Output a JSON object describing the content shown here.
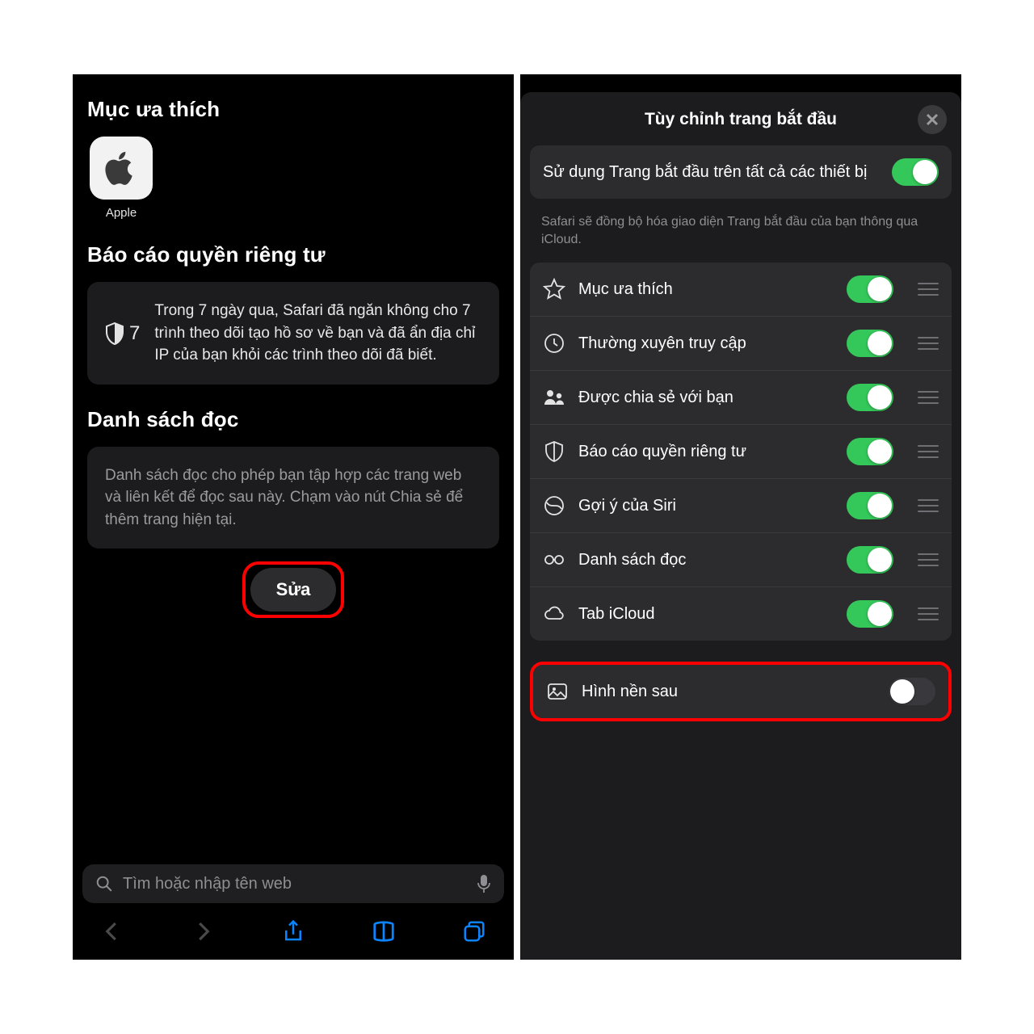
{
  "left": {
    "favorites_title": "Mục ưa thích",
    "favorite_label": "Apple",
    "privacy_title": "Báo cáo quyền riêng tư",
    "privacy_count": "7",
    "privacy_text": "Trong 7 ngày qua, Safari đã ngăn không cho 7 trình theo dõi tạo hồ sơ về bạn và đã ẩn địa chỉ IP của bạn khỏi các trình theo dõi đã biết.",
    "reading_title": "Danh sách đọc",
    "reading_text": "Danh sách đọc cho phép bạn tập hợp các trang web và liên kết để đọc sau này. Chạm vào nút Chia sẻ để thêm trang hiện tại.",
    "edit_label": "Sửa",
    "search_placeholder": "Tìm hoặc nhập tên web"
  },
  "right": {
    "sheet_title": "Tùy chỉnh trang bắt đầu",
    "sync_label": "Sử dụng Trang bắt đầu trên tất cả các thiết bị",
    "sync_footer": "Safari sẽ đồng bộ hóa giao diện Trang bắt đầu của bạn thông qua iCloud.",
    "rows": [
      {
        "label": "Mục ưa thích"
      },
      {
        "label": "Thường xuyên truy cập"
      },
      {
        "label": "Được chia sẻ với bạn"
      },
      {
        "label": "Báo cáo quyền riêng tư"
      },
      {
        "label": "Gợi ý của Siri"
      },
      {
        "label": "Danh sách đọc"
      },
      {
        "label": "Tab iCloud"
      }
    ],
    "background_label": "Hình nền sau"
  }
}
